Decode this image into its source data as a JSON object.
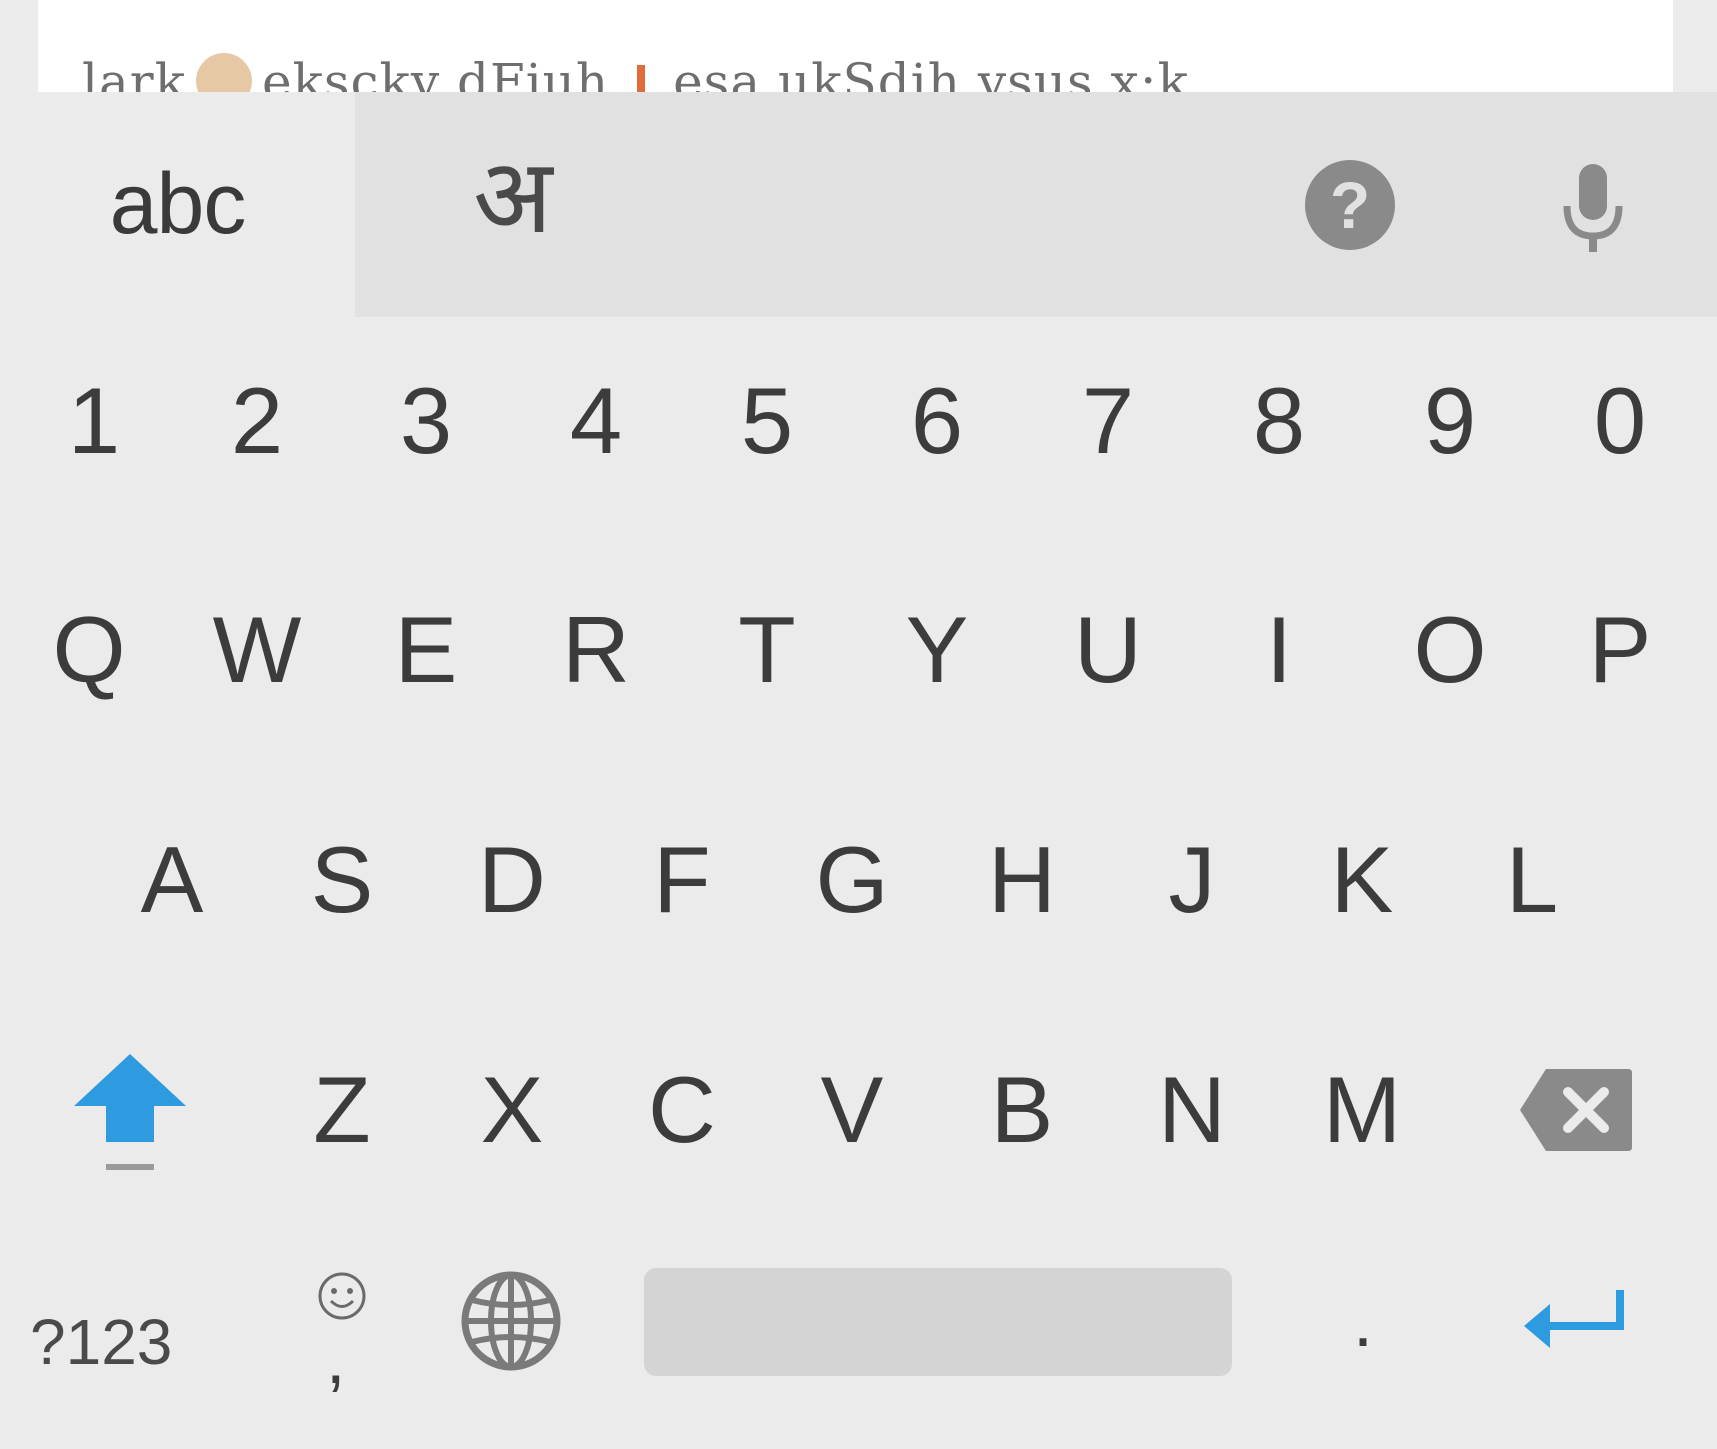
{
  "text_field": {
    "visible_text_part1": "lark",
    "visible_text_part2": "ekscky dFiuh",
    "visible_text_part3": "esa ukSdih vsus x:k"
  },
  "language_bar": {
    "latin_label": "abc",
    "devanagari_label": "अ",
    "help_icon": "help-icon",
    "mic_icon": "microphone-icon"
  },
  "keyboard": {
    "number_row": [
      "1",
      "2",
      "3",
      "4",
      "5",
      "6",
      "7",
      "8",
      "9",
      "0"
    ],
    "row1": [
      "Q",
      "W",
      "E",
      "R",
      "T",
      "Y",
      "U",
      "I",
      "O",
      "P"
    ],
    "row2": [
      "A",
      "S",
      "D",
      "F",
      "G",
      "H",
      "J",
      "K",
      "L"
    ],
    "row3": [
      "Z",
      "X",
      "C",
      "V",
      "B",
      "N",
      "M"
    ],
    "shift_icon": "shift-arrow-icon",
    "backspace_icon": "backspace-icon",
    "symbols_label": "?123",
    "comma_label": ",",
    "emoji_icon": "smiley-icon",
    "globe_icon": "globe-icon",
    "period_label": ".",
    "enter_icon": "enter-arrow-icon"
  },
  "colors": {
    "accent": "#2e9be0",
    "keyboard_bg": "#ebebeb",
    "strip_bg": "#e1e1e1",
    "key_text": "#3c3c3c",
    "space_bar": "#d4d4d4"
  }
}
